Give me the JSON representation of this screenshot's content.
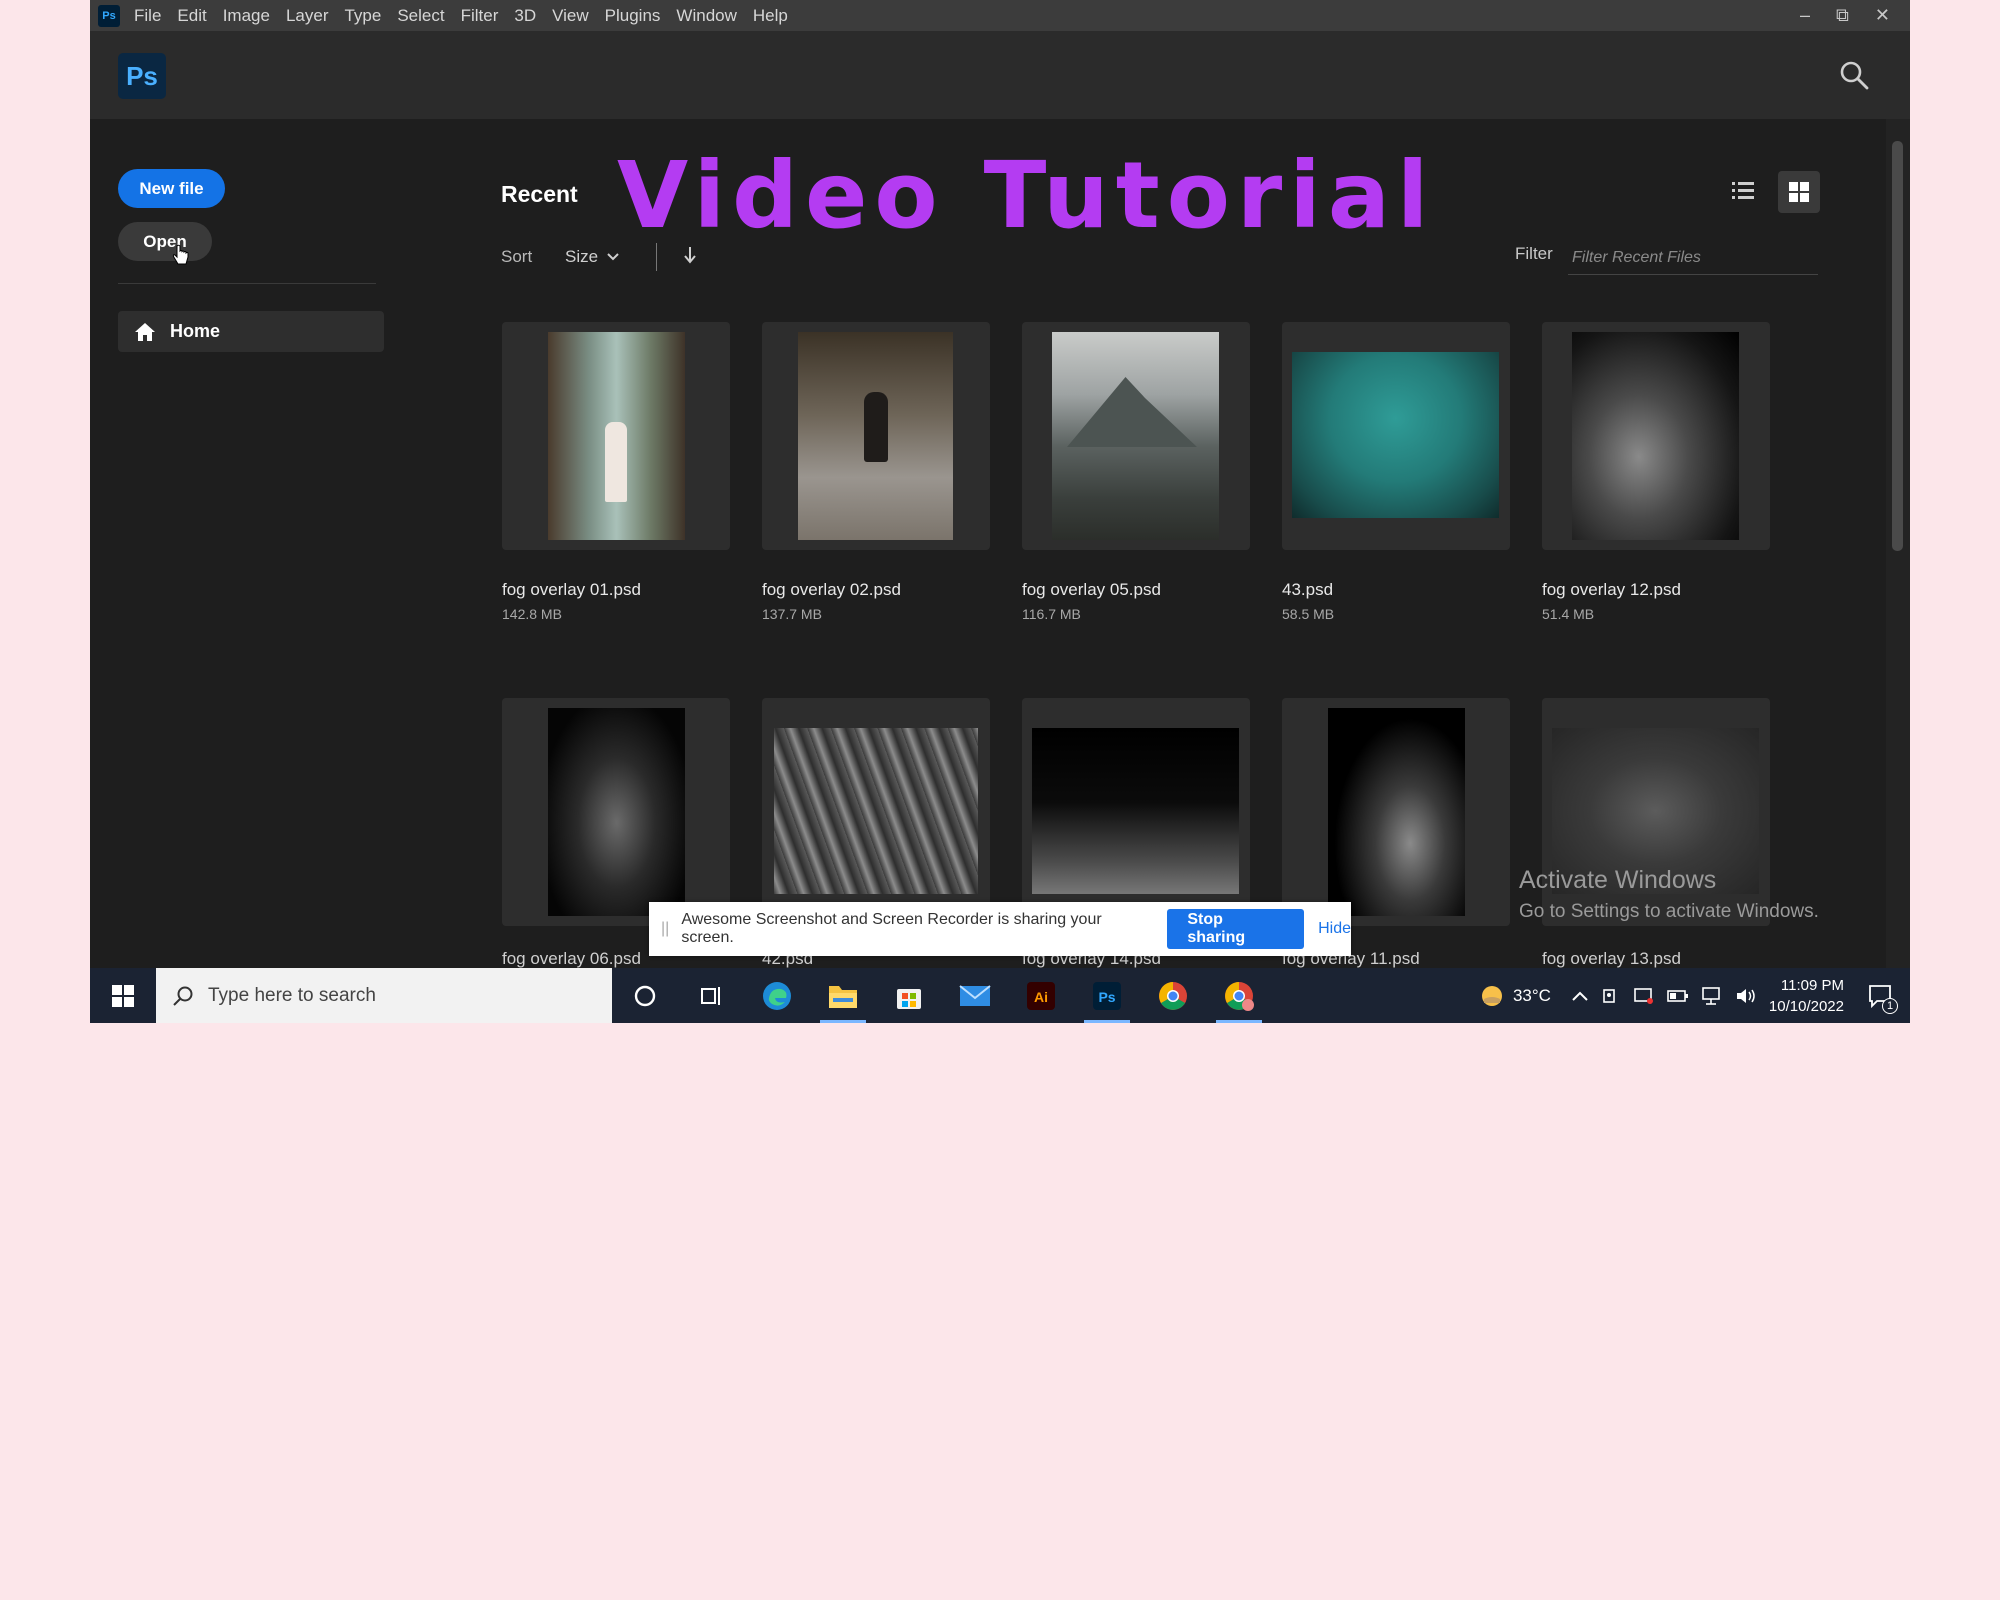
{
  "menubar": {
    "app_badge": "Ps",
    "items": [
      "File",
      "Edit",
      "Image",
      "Layer",
      "Type",
      "Select",
      "Filter",
      "3D",
      "View",
      "Plugins",
      "Window",
      "Help"
    ]
  },
  "header": {
    "logo": "Ps",
    "search_icon": "search-icon"
  },
  "sidebar": {
    "new_file": "New file",
    "open": "Open",
    "home": "Home"
  },
  "main": {
    "recent_title": "Recent",
    "overlay_title": "Video Tutorial",
    "sort_label": "Sort",
    "sort_value": "Size",
    "filter_label": "Filter",
    "filter_placeholder": "Filter Recent Files",
    "files_row1": [
      {
        "name": "fog overlay 01.psd",
        "size": "142.8 MB"
      },
      {
        "name": "fog overlay 02.psd",
        "size": "137.7 MB"
      },
      {
        "name": "fog overlay 05.psd",
        "size": "116.7 MB"
      },
      {
        "name": "43.psd",
        "size": "58.5 MB"
      },
      {
        "name": "fog overlay 12.psd",
        "size": "51.4 MB"
      }
    ],
    "files_row2": [
      {
        "name": "fog overlay 06.psd"
      },
      {
        "name": "42.psd"
      },
      {
        "name": "fog overlay 14.psd"
      },
      {
        "name": "fog overlay 11.psd"
      },
      {
        "name": "fog overlay 13.psd"
      }
    ]
  },
  "activate_windows": {
    "title": "Activate Windows",
    "subtitle": "Go to Settings to activate Windows."
  },
  "share_bar": {
    "grip": "||",
    "message": "Awesome Screenshot and Screen Recorder is sharing your screen.",
    "stop": "Stop sharing",
    "hide": "Hide"
  },
  "taskbar": {
    "search_placeholder": "Type here to search",
    "temperature": "33°C",
    "time": "11:09 PM",
    "date": "10/10/2022",
    "notification_count": "1",
    "apps": [
      "cortana-icon",
      "task-view-icon",
      "edge-icon",
      "file-explorer-icon",
      "store-icon",
      "mail-icon",
      "illustrator-icon",
      "photoshop-icon",
      "chrome-icon",
      "chrome-profile-icon"
    ]
  },
  "colors": {
    "accent": "#1473e6",
    "overlay_title": "#b43cf2",
    "background": "#fce6ea",
    "app_bg": "#1e1e1e"
  }
}
